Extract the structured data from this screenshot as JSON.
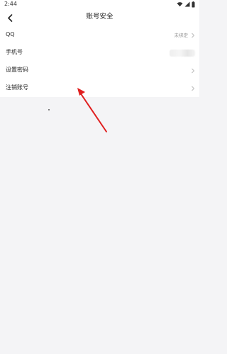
{
  "status_bar": {
    "time": "2:44",
    "icons": [
      "wifi-icon",
      "signal-icon",
      "battery-icon"
    ]
  },
  "nav": {
    "back_icon": "chevron-left-icon",
    "title": "账号安全"
  },
  "rows": [
    {
      "label": "QQ",
      "value": "未绑定",
      "chevron": true
    },
    {
      "label": "手机号",
      "value": "",
      "blurred": true,
      "chevron": false
    },
    {
      "label": "设置密码",
      "value": "",
      "chevron": true
    },
    {
      "label": "注销账号",
      "value": "",
      "chevron": true
    }
  ],
  "annotation": {
    "arrow_icon": "red-arrow-icon",
    "color": "#e02020"
  },
  "colors": {
    "background": "#f4f4f6",
    "surface": "#ffffff",
    "text": "#222222",
    "secondary_text": "#9a9a9a"
  }
}
